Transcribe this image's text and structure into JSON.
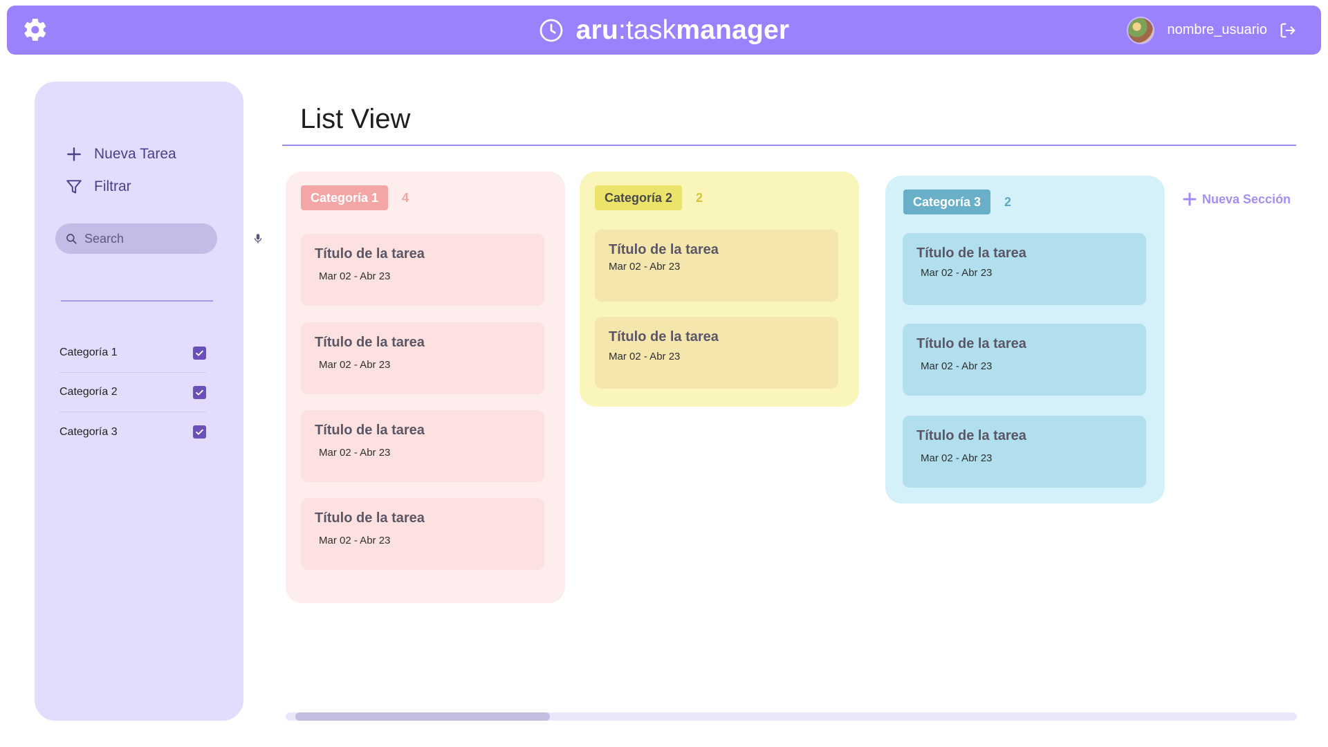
{
  "header": {
    "brand_bold_1": "aru",
    "brand_colon": ":",
    "brand_light": "task",
    "brand_bold_2": "manager",
    "username": "nombre_usuario",
    "colors": {
      "bar": "#9b82fc",
      "text": "#ffffff"
    }
  },
  "sidebar": {
    "new_task_label": "Nueva Tarea",
    "filter_label": "Filtrar",
    "search_placeholder": "Search",
    "search_value": "",
    "categories": [
      {
        "label": "Categoría 1",
        "checked": true
      },
      {
        "label": "Categoría 2",
        "checked": true
      },
      {
        "label": "Categoría 3",
        "checked": true
      }
    ]
  },
  "main": {
    "title": "List View",
    "new_section_label": "Nueva Sección",
    "columns": [
      {
        "name": "Categoría 1",
        "count": "4",
        "colors": {
          "bg": "#fdeeed",
          "pill": "#f4a6a6",
          "pill_text": "#ffffff",
          "count": "#f0a3a0",
          "card": "#fde1e1"
        },
        "tasks": [
          {
            "title": "Título de la tarea",
            "dates": "Mar 02 - Abr 23"
          },
          {
            "title": "Título de la tarea",
            "dates": "Mar 02 - Abr 23"
          },
          {
            "title": "Título de la tarea",
            "dates": "Mar 02 - Abr 23"
          },
          {
            "title": "Título de la tarea",
            "dates": "Mar 02 - Abr 23"
          }
        ]
      },
      {
        "name": "Categoría 2",
        "count": "2",
        "colors": {
          "bg": "#f9f5bb",
          "pill": "#ece36b",
          "pill_text": "#4a4a4a",
          "count": "#d8c23a",
          "card": "#f5e6ad"
        },
        "tasks": [
          {
            "title": "Título de la tarea",
            "dates": "Mar 02 - Abr 23"
          },
          {
            "title": "Título de la tarea",
            "dates": "Mar 02 - Abr 23"
          }
        ]
      },
      {
        "name": "Categoría 3",
        "count": "2",
        "colors": {
          "bg": "#d4f0f8",
          "pill": "#69afc8",
          "pill_text": "#ffffff",
          "count": "#5fa7c2",
          "card": "#b1dfee"
        },
        "tasks": [
          {
            "title": "Título de la tarea",
            "dates": "Mar 02 - Abr 23"
          },
          {
            "title": "Título de la tarea",
            "dates": "Mar 02 - Abr 23"
          },
          {
            "title": "Título de la tarea",
            "dates": "Mar 02 - Abr 23"
          }
        ]
      }
    ]
  },
  "icons": [
    "gear-icon",
    "clock-icon",
    "logout-icon",
    "plus-icon",
    "filter-icon",
    "search-icon",
    "microphone-icon",
    "checkbox-checked-icon"
  ]
}
